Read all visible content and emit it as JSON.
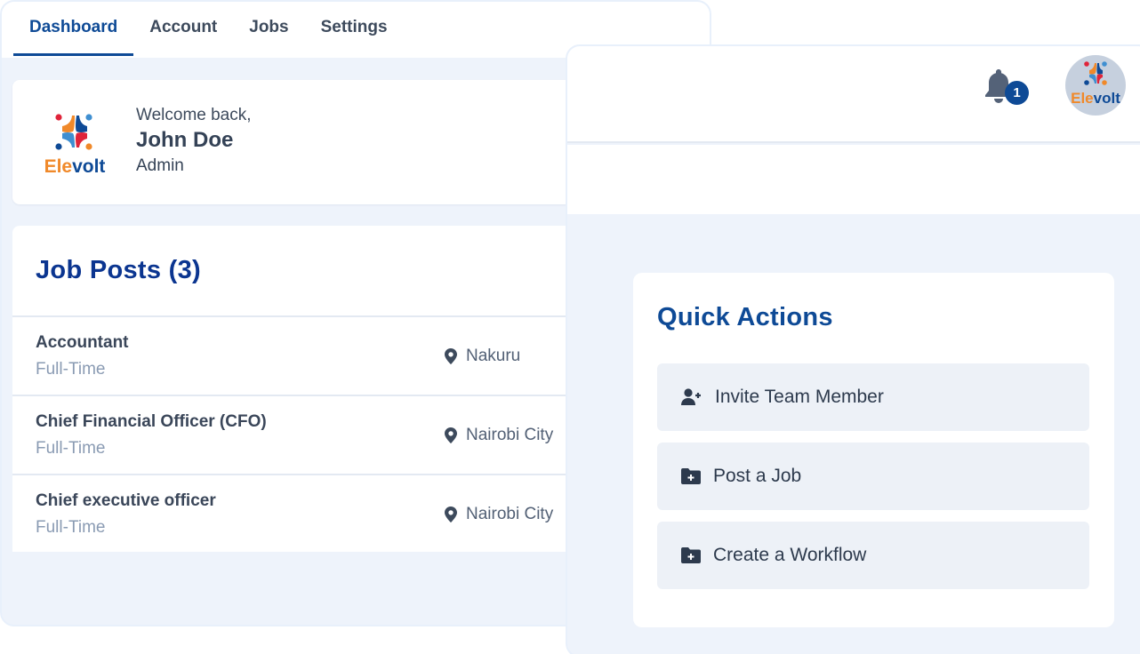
{
  "tabs": [
    {
      "label": "Dashboard",
      "active": true
    },
    {
      "label": "Account",
      "active": false
    },
    {
      "label": "Jobs",
      "active": false
    },
    {
      "label": "Settings",
      "active": false
    }
  ],
  "welcome": {
    "greeting": "Welcome back,",
    "name": "John Doe",
    "role": "Admin",
    "logo_text_left": "Ele",
    "logo_text_right": "volt"
  },
  "job_posts": {
    "title": "Job Posts (3)",
    "items": [
      {
        "title": "Accountant",
        "type": "Full-Time",
        "location": "Nakuru"
      },
      {
        "title": "Chief Financial Officer (CFO)",
        "type": "Full-Time",
        "location": "Nairobi City"
      },
      {
        "title": "Chief executive officer",
        "type": "Full-Time",
        "location": "Nairobi City"
      }
    ]
  },
  "header": {
    "notification_icon": "bell-icon",
    "notification_count": "1",
    "avatar_icon": "elevolt-logo"
  },
  "quick_actions": {
    "title": "Quick Actions",
    "items": [
      {
        "label": "Invite Team Member",
        "icon": "user-plus-icon"
      },
      {
        "label": "Post a Job",
        "icon": "folder-plus-icon"
      },
      {
        "label": "Create a Workflow",
        "icon": "folder-plus-icon"
      }
    ]
  },
  "colors": {
    "brand_navy": "#0e4a96",
    "brand_orange": "#f0892a",
    "brand_red": "#e0243a",
    "brand_light_blue": "#3f8fd1",
    "background": "#eef3fb"
  }
}
